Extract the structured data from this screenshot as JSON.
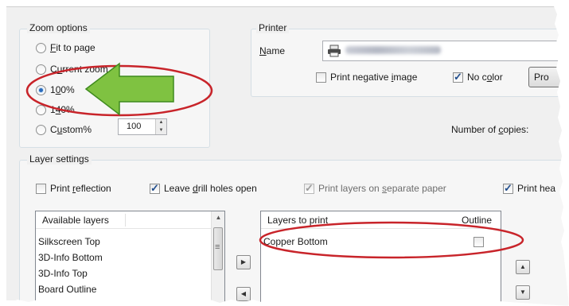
{
  "zoom_options": {
    "title": "Zoom options",
    "options": [
      {
        "pre": "",
        "accel": "F",
        "post": "it to page",
        "checked": false
      },
      {
        "pre": "C",
        "accel": "u",
        "post": "rrent zoom",
        "checked": false
      },
      {
        "pre": "1",
        "accel": "0",
        "post": "0%",
        "checked": true
      },
      {
        "pre": "1",
        "accel": "4",
        "post": "0%",
        "checked": false
      },
      {
        "pre": "C",
        "accel": "u",
        "post": "stom%",
        "checked": false
      }
    ],
    "custom_value": "100"
  },
  "printer": {
    "title": "Printer",
    "name_label_pre": "",
    "name_label_accel": "N",
    "name_label_post": "ame",
    "print_negative_pre": "Print negative ",
    "print_negative_accel": "i",
    "print_negative_post": "mage",
    "print_negative_checked": false,
    "no_color_pre": "No c",
    "no_color_accel": "o",
    "no_color_post": "lor",
    "no_color_checked": true,
    "properties_button_label": "Pro",
    "copies_pre": "Number of ",
    "copies_accel": "c",
    "copies_post": "opies:"
  },
  "layer_settings": {
    "title": "Layer settings",
    "print_reflection_pre": "Print ",
    "print_reflection_accel": "r",
    "print_reflection_post": "eflection",
    "print_reflection_checked": false,
    "leave_drill_pre": "Leave ",
    "leave_drill_accel": "d",
    "leave_drill_post": "rill holes open",
    "leave_drill_checked": true,
    "separate_pre": "Print layers on ",
    "separate_accel": "s",
    "separate_post": "eparate paper",
    "separate_checked": true,
    "print_head_label": "Print hea",
    "print_head_checked": true,
    "available_header": "Available layers",
    "available_layers": [
      "Silkscreen Top",
      "3D-Info Bottom",
      "3D-Info Top",
      "Board Outline"
    ],
    "to_print_header": "Layers to print",
    "outline_header": "Outline",
    "to_print_layers": [
      {
        "name": "Copper Bottom",
        "outline": false
      }
    ]
  },
  "colors": {
    "annotation_red": "#c8242a",
    "arrow_green": "#7fc241",
    "arrow_green_dark": "#3f8a1e",
    "group_border": "#d5dfe5"
  }
}
